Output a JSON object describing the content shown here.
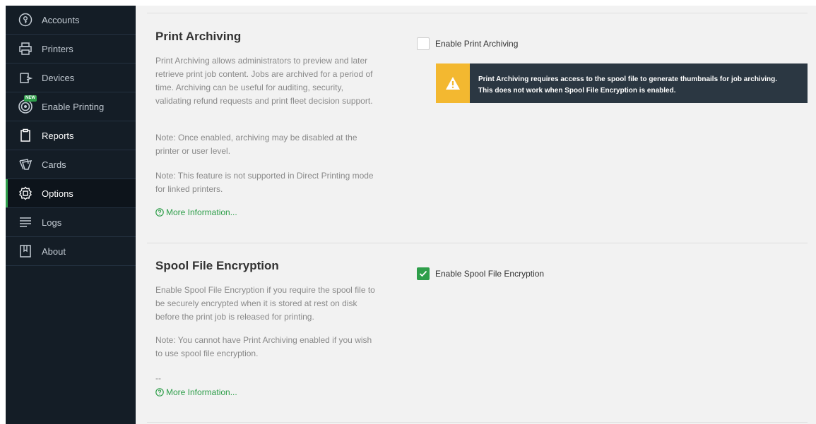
{
  "sidebar": {
    "items": [
      {
        "label": "Accounts",
        "icon": "account-key-icon"
      },
      {
        "label": "Printers",
        "icon": "printer-icon"
      },
      {
        "label": "Devices",
        "icon": "device-icon"
      },
      {
        "label": "Enable Printing",
        "icon": "target-icon",
        "badge": "NEW"
      },
      {
        "label": "Reports",
        "icon": "clipboard-icon"
      },
      {
        "label": "Cards",
        "icon": "cards-icon"
      },
      {
        "label": "Options",
        "icon": "gear-icon",
        "active": true
      },
      {
        "label": "Logs",
        "icon": "lines-icon"
      },
      {
        "label": "About",
        "icon": "book-icon"
      }
    ]
  },
  "print_archiving": {
    "title": "Print Archiving",
    "desc1": "Print Archiving allows administrators to preview and later retrieve print job content. Jobs are archived for a period of time. Archiving can be useful for auditing, security, validating refund requests and print fleet decision support.",
    "note1": "Note: Once enabled, archiving may be disabled at the printer or user level.",
    "note2": "Note: This feature is not supported in Direct Printing mode for linked printers.",
    "more_info": "More Information...",
    "checkbox_label": "Enable Print Archiving",
    "checked": false,
    "warning_line1": "Print Archiving requires access to the spool file to generate thumbnails for job archiving.",
    "warning_line2": "This does not work when Spool File Encryption is enabled."
  },
  "spool_encryption": {
    "title": "Spool File Encryption",
    "desc1": "Enable Spool File Encryption if you require the spool file to be securely encrypted when it is stored at rest on disk before the print job is released for printing.",
    "note1": "Note: You cannot have Print Archiving enabled if you wish to use spool file encryption.",
    "separator": "--",
    "more_info": "More Information...",
    "checkbox_label": "Enable Spool File Encryption",
    "checked": true
  },
  "colors": {
    "accent": "#2e9e4a",
    "warning": "#f3b830",
    "sidebar_bg": "#141d26"
  }
}
